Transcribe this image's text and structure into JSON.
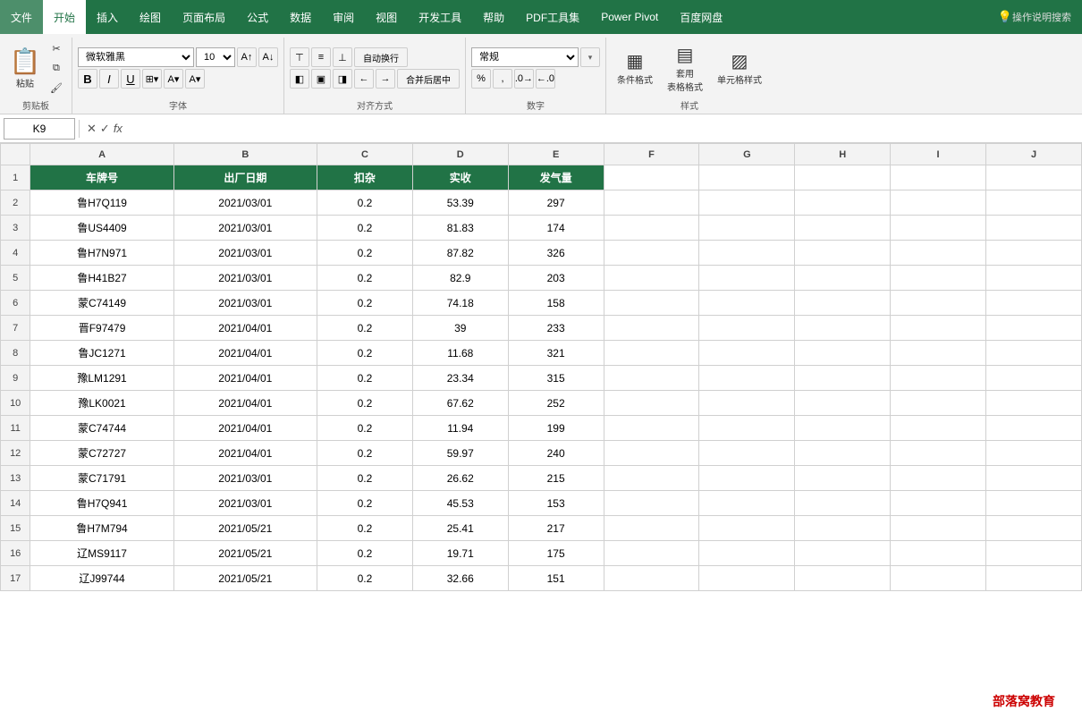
{
  "menu": {
    "items": [
      "文件",
      "开始",
      "插入",
      "绘图",
      "页面布局",
      "公式",
      "数据",
      "审阅",
      "视图",
      "开发工具",
      "帮助",
      "PDF工具集",
      "Power Pivot",
      "百度网盘"
    ],
    "active": "开始",
    "search_placeholder": "操作说明搜索"
  },
  "ribbon": {
    "clipboard_label": "剪贴板",
    "paste_label": "粘贴",
    "cut_label": "✂",
    "copy_label": "⧉",
    "format_painter_label": "🖌",
    "font_label": "字体",
    "font_name": "微软雅黑",
    "font_size": "10",
    "bold_label": "B",
    "italic_label": "I",
    "underline_label": "U",
    "align_label": "对齐方式",
    "wrap_text_label": "自动换行",
    "merge_center_label": "合并后居中",
    "number_label": "数字",
    "number_format": "常规",
    "styles_label": "样式",
    "conditional_format_label": "条件格式",
    "table_format_label": "套用\n表格格式",
    "cell_styles_label": "单元格样式"
  },
  "formula_bar": {
    "cell_ref": "K9",
    "formula": ""
  },
  "columns": {
    "headers": [
      "",
      "A",
      "B",
      "C",
      "D",
      "E",
      "F",
      "G",
      "H",
      "I",
      "J"
    ],
    "widths": [
      25,
      120,
      120,
      80,
      80,
      80,
      80,
      80,
      80,
      80,
      80
    ]
  },
  "rows": [
    {
      "num": 1,
      "A": "车牌号",
      "B": "出厂日期",
      "C": "扣杂",
      "D": "实收",
      "E": "发气量",
      "header": true
    },
    {
      "num": 2,
      "A": "鲁H7Q119",
      "B": "2021/03/01",
      "C": "0.2",
      "D": "53.39",
      "E": "297"
    },
    {
      "num": 3,
      "A": "鲁US4409",
      "B": "2021/03/01",
      "C": "0.2",
      "D": "81.83",
      "E": "174"
    },
    {
      "num": 4,
      "A": "鲁H7N971",
      "B": "2021/03/01",
      "C": "0.2",
      "D": "87.82",
      "E": "326"
    },
    {
      "num": 5,
      "A": "鲁H41B27",
      "B": "2021/03/01",
      "C": "0.2",
      "D": "82.9",
      "E": "203"
    },
    {
      "num": 6,
      "A": "蒙C74149",
      "B": "2021/03/01",
      "C": "0.2",
      "D": "74.18",
      "E": "158"
    },
    {
      "num": 7,
      "A": "晋F97479",
      "B": "2021/04/01",
      "C": "0.2",
      "D": "39",
      "E": "233"
    },
    {
      "num": 8,
      "A": "鲁JC1271",
      "B": "2021/04/01",
      "C": "0.2",
      "D": "11.68",
      "E": "321"
    },
    {
      "num": 9,
      "A": "豫LM1291",
      "B": "2021/04/01",
      "C": "0.2",
      "D": "23.34",
      "E": "315"
    },
    {
      "num": 10,
      "A": "豫LK0021",
      "B": "2021/04/01",
      "C": "0.2",
      "D": "67.62",
      "E": "252"
    },
    {
      "num": 11,
      "A": "蒙C74744",
      "B": "2021/04/01",
      "C": "0.2",
      "D": "11.94",
      "E": "199"
    },
    {
      "num": 12,
      "A": "蒙C72727",
      "B": "2021/04/01",
      "C": "0.2",
      "D": "59.97",
      "E": "240"
    },
    {
      "num": 13,
      "A": "蒙C71791",
      "B": "2021/03/01",
      "C": "0.2",
      "D": "26.62",
      "E": "215"
    },
    {
      "num": 14,
      "A": "鲁H7Q941",
      "B": "2021/03/01",
      "C": "0.2",
      "D": "45.53",
      "E": "153"
    },
    {
      "num": 15,
      "A": "鲁H7M794",
      "B": "2021/05/21",
      "C": "0.2",
      "D": "25.41",
      "E": "217"
    },
    {
      "num": 16,
      "A": "辽MS9117",
      "B": "2021/05/21",
      "C": "0.2",
      "D": "19.71",
      "E": "175"
    },
    {
      "num": 17,
      "A": "辽J99744",
      "B": "2021/05/21",
      "C": "0.2",
      "D": "32.66",
      "E": "151"
    }
  ],
  "watermark": "部落窝教育"
}
